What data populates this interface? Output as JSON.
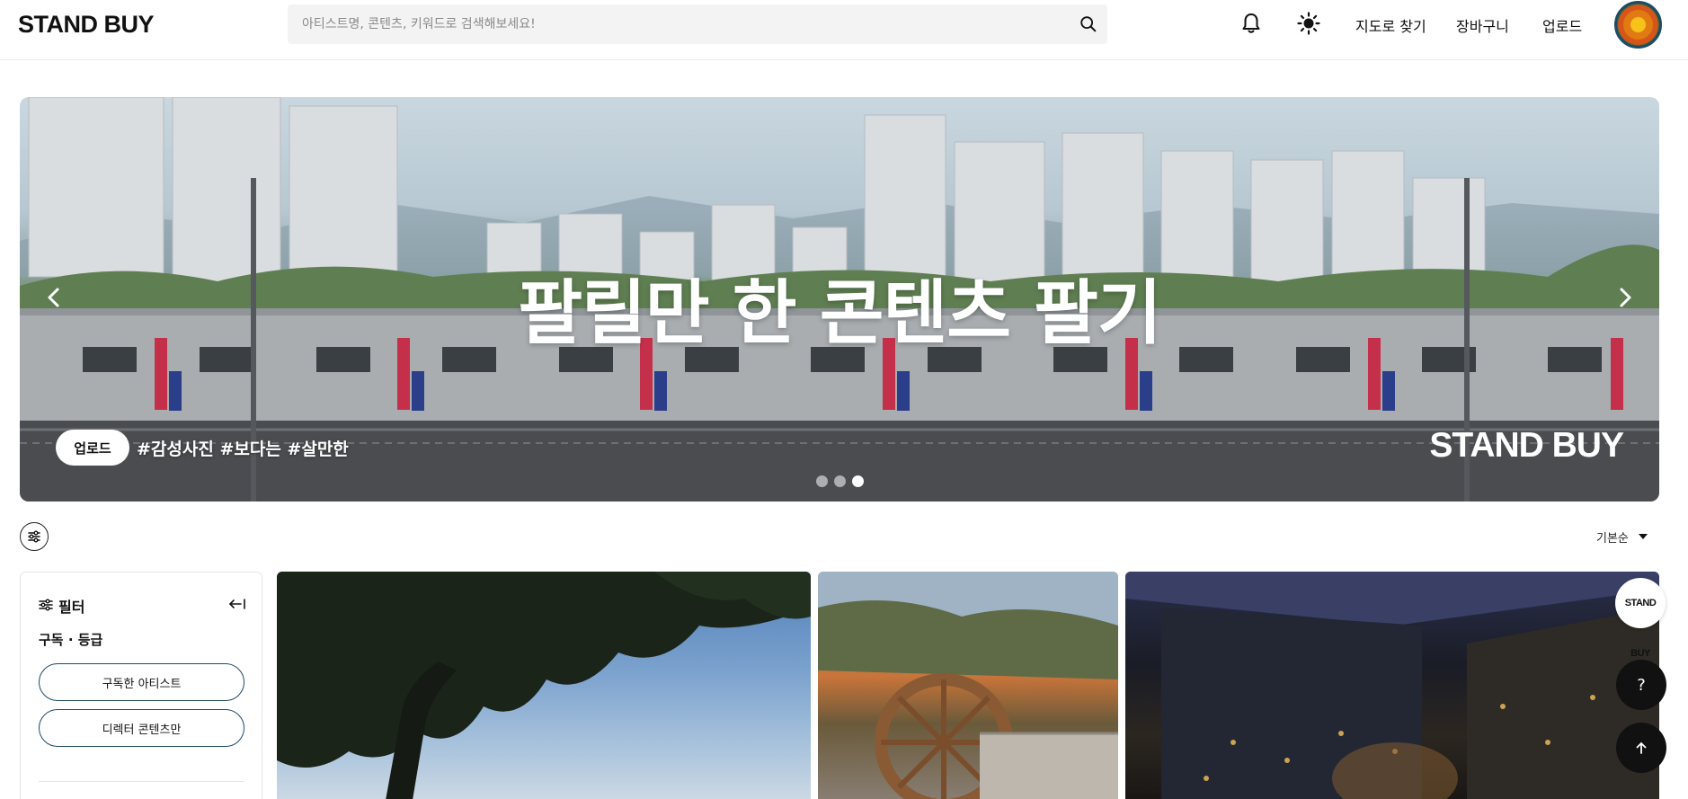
{
  "header": {
    "logo": "STAND BUY",
    "search_placeholder": "아티스트명, 콘텐츠, 키워드로 검색해보세요!",
    "nav": [
      "지도로 찾기",
      "장바구니",
      "업로드"
    ]
  },
  "hero": {
    "title": "팔릴만 한 콘텐츠 팔기",
    "upload_label": "업로드",
    "tags": "#감성사진 #보다는 #살만한",
    "brand": "STAND BUY",
    "slide_count": 3,
    "active_slide": 3
  },
  "toolbar": {
    "sort_label": "기본순"
  },
  "filter": {
    "title": "필터",
    "section_title": "구독 · 등급",
    "buttons": [
      "구독한 아티스트",
      "디렉터 콘텐츠만"
    ]
  },
  "floating": {
    "brand": "STAND BUY",
    "help": "?"
  },
  "colors": {
    "accent_border": "#1e4a66",
    "dark_button": "#111111",
    "search_bg": "#f3f3f3"
  }
}
